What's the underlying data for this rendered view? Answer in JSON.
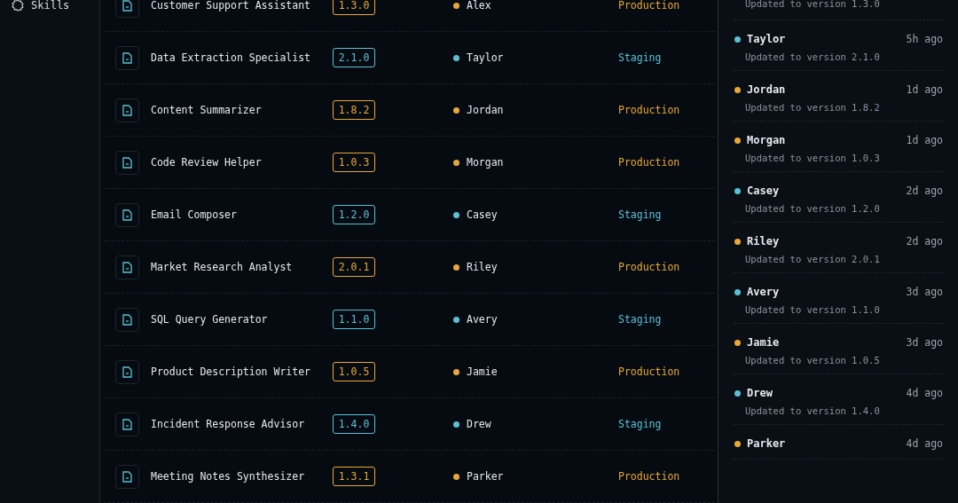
{
  "sidebar": {
    "items": [
      {
        "label": "Skills",
        "selected": false
      }
    ]
  },
  "table": {
    "rows": [
      {
        "name": "Customer Support Assistant",
        "version": "1.3.0",
        "owner": "Alex",
        "stage": "Production",
        "color": "#e8a838"
      },
      {
        "name": "Data Extraction Specialist",
        "version": "2.1.0",
        "owner": "Taylor",
        "stage": "Staging",
        "color": "#5bc0d4"
      },
      {
        "name": "Content Summarizer",
        "version": "1.8.2",
        "owner": "Jordan",
        "stage": "Production",
        "color": "#e8a838"
      },
      {
        "name": "Code Review Helper",
        "version": "1.0.3",
        "owner": "Morgan",
        "stage": "Production",
        "color": "#e8a838"
      },
      {
        "name": "Email Composer",
        "version": "1.2.0",
        "owner": "Casey",
        "stage": "Staging",
        "color": "#5bc0d4"
      },
      {
        "name": "Market Research Analyst",
        "version": "2.0.1",
        "owner": "Riley",
        "stage": "Production",
        "color": "#e8a838"
      },
      {
        "name": "SQL Query Generator",
        "version": "1.1.0",
        "owner": "Avery",
        "stage": "Staging",
        "color": "#5bc0d4"
      },
      {
        "name": "Product Description Writer",
        "version": "1.0.5",
        "owner": "Jamie",
        "stage": "Production",
        "color": "#e8a838"
      },
      {
        "name": "Incident Response Advisor",
        "version": "1.4.0",
        "owner": "Drew",
        "stage": "Staging",
        "color": "#5bc0d4"
      },
      {
        "name": "Meeting Notes Synthesizer",
        "version": "1.3.1",
        "owner": "Parker",
        "stage": "Production",
        "color": "#e8a838"
      }
    ]
  },
  "activity": {
    "items": [
      {
        "detail": "Updated to version 1.3.0"
      },
      {
        "name": "Taylor",
        "time": "5h ago",
        "detail": "Updated to version 2.1.0",
        "color": "#5bc0d4"
      },
      {
        "name": "Jordan",
        "time": "1d ago",
        "detail": "Updated to version 1.8.2",
        "color": "#e8a838"
      },
      {
        "name": "Morgan",
        "time": "1d ago",
        "detail": "Updated to version 1.0.3",
        "color": "#e8a838"
      },
      {
        "name": "Casey",
        "time": "2d ago",
        "detail": "Updated to version 1.2.0",
        "color": "#5bc0d4"
      },
      {
        "name": "Riley",
        "time": "2d ago",
        "detail": "Updated to version 2.0.1",
        "color": "#e8a838"
      },
      {
        "name": "Avery",
        "time": "3d ago",
        "detail": "Updated to version 1.1.0",
        "color": "#5bc0d4"
      },
      {
        "name": "Jamie",
        "time": "3d ago",
        "detail": "Updated to version 1.0.5",
        "color": "#e8a838"
      },
      {
        "name": "Drew",
        "time": "4d ago",
        "detail": "Updated to version 1.4.0",
        "color": "#5bc0d4"
      },
      {
        "name": "Parker",
        "time": "4d ago",
        "color": "#e8a838"
      }
    ]
  }
}
